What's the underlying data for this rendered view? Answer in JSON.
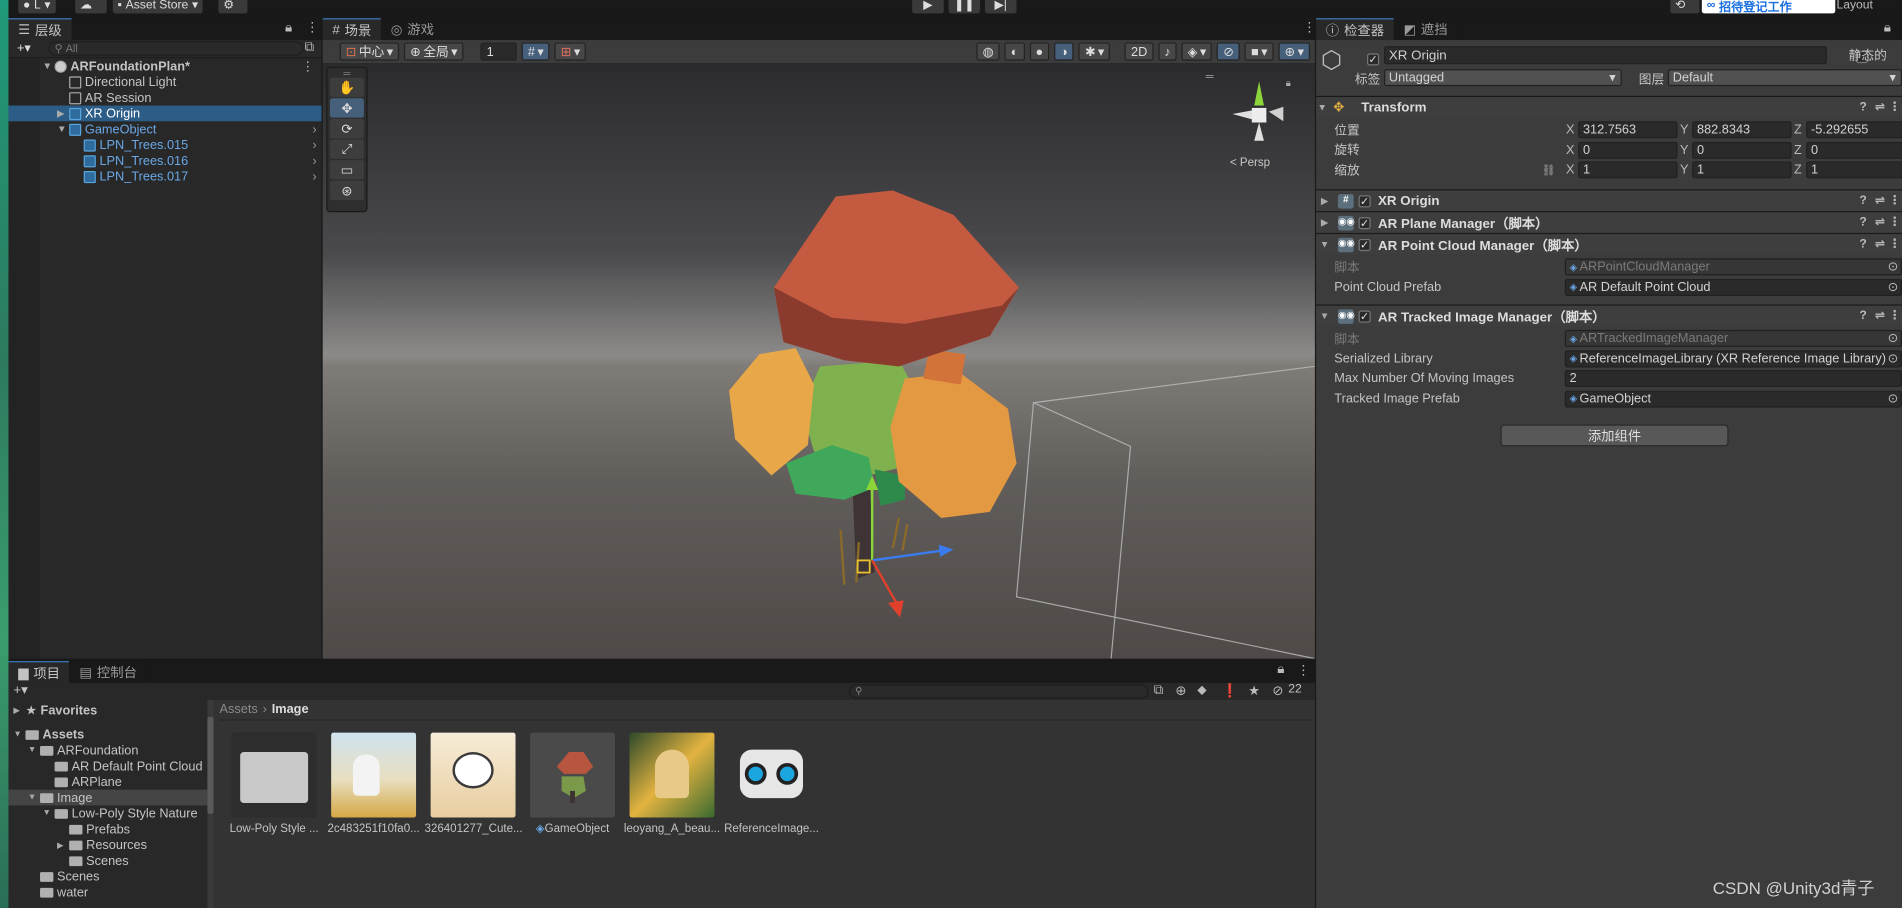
{
  "topbar": {
    "account": "L",
    "asset_store": "Asset Store",
    "login_badge": "招待登记工作",
    "layout": "Layout"
  },
  "hierarchy": {
    "tab": "层级",
    "search_placeholder": "All",
    "items": [
      {
        "label": "ARFoundationPlan*",
        "depth": 0,
        "expanded": true,
        "scene": true
      },
      {
        "label": "Directional Light",
        "depth": 1
      },
      {
        "label": "AR Session",
        "depth": 1
      },
      {
        "label": "XR Origin",
        "depth": 1,
        "selected": true,
        "prefab": true
      },
      {
        "label": "GameObject",
        "depth": 1,
        "prefab": true,
        "expanded": true
      },
      {
        "label": "LPN_Trees.015",
        "depth": 2,
        "prefab": true
      },
      {
        "label": "LPN_Trees.016",
        "depth": 2,
        "prefab": true
      },
      {
        "label": "LPN_Trees.017",
        "depth": 2,
        "prefab": true
      }
    ]
  },
  "scene": {
    "tab_scene": "场景",
    "tab_game": "游戏",
    "pivot": "中心",
    "space": "全局",
    "grid_value": "1",
    "mode_2d": "2D",
    "persp": "< Persp"
  },
  "inspector": {
    "tab_inspector": "检查器",
    "tab_occlusion": "遮挡",
    "object_name": "XR Origin",
    "static_label": "静态的",
    "tag_label": "标签",
    "tag_value": "Untagged",
    "layer_label": "图层",
    "layer_value": "Default",
    "transform": {
      "title": "Transform",
      "rows": [
        {
          "label": "位置",
          "x": "312.7563",
          "y": "882.8343",
          "z": "-5.292655"
        },
        {
          "label": "旋转",
          "x": "0",
          "y": "0",
          "z": "0"
        },
        {
          "label": "缩放",
          "x": "1",
          "y": "1",
          "z": "1"
        }
      ]
    },
    "components": [
      {
        "title": "XR Origin"
      },
      {
        "title": "AR Plane Manager（脚本）"
      },
      {
        "title": "AR Point Cloud Manager（脚本）",
        "props": [
          {
            "label": "脚本",
            "value": "ARPointCloudManager",
            "dim": true
          },
          {
            "label": "Point Cloud Prefab",
            "value": "AR Default Point Cloud"
          }
        ]
      },
      {
        "title": "AR Tracked Image Manager（脚本）",
        "props": [
          {
            "label": "脚本",
            "value": "ARTrackedImageManager",
            "dim": true
          },
          {
            "label": "Serialized Library",
            "value": "ReferenceImageLibrary (XR Reference Image Library)"
          },
          {
            "label": "Max Number Of Moving Images",
            "value": "2"
          },
          {
            "label": "Tracked Image Prefab",
            "value": "GameObject"
          }
        ]
      }
    ],
    "add_component": "添加组件"
  },
  "project": {
    "tab_project": "项目",
    "tab_console": "控制台",
    "count": "22",
    "breadcrumb": [
      "Assets",
      "Image"
    ],
    "tree": [
      {
        "label": "Favorites",
        "depth": 0,
        "star": true
      },
      {
        "label": "Assets",
        "depth": 0,
        "bold": true
      },
      {
        "label": "ARFoundation",
        "depth": 1
      },
      {
        "label": "AR Default Point Cloud",
        "depth": 2
      },
      {
        "label": "ARPlane",
        "depth": 2
      },
      {
        "label": "Image",
        "depth": 1,
        "selected": true
      },
      {
        "label": "Low-Poly Style Nature",
        "depth": 2
      },
      {
        "label": "Prefabs",
        "depth": 3
      },
      {
        "label": "Resources",
        "depth": 3
      },
      {
        "label": "Scenes",
        "depth": 3
      },
      {
        "label": "Scenes",
        "depth": 1
      },
      {
        "label": "water",
        "depth": 1
      }
    ],
    "assets": [
      "Low-Poly Style ...",
      "2c483251f10fa0...",
      "326401277_Cute...",
      "GameObject",
      "leoyang_A_beau...",
      "ReferenceImage..."
    ]
  },
  "watermark": "CSDN @Unity3d青子"
}
